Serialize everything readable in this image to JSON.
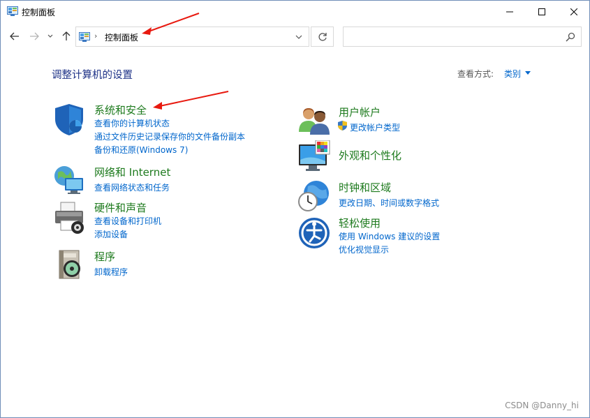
{
  "window": {
    "title": "控制面板"
  },
  "nav": {
    "back_icon": "arrow-left-icon",
    "forward_icon": "arrow-right-icon",
    "recent_icon": "chevron-down-icon",
    "up_icon": "arrow-up-icon"
  },
  "address": {
    "separator": "›",
    "path": "控制面板"
  },
  "search": {
    "placeholder": ""
  },
  "header": {
    "title": "调整计算机的设置",
    "viewby_label": "查看方式:",
    "viewby_value": "类别"
  },
  "categories": {
    "system": {
      "title": "系统和安全",
      "links": [
        "查看你的计算机状态",
        "通过文件历史记录保存你的文件备份副本",
        "备份和还原(Windows 7)"
      ]
    },
    "network": {
      "title": "网络和 Internet",
      "links": [
        "查看网络状态和任务"
      ]
    },
    "hardware": {
      "title": "硬件和声音",
      "links": [
        "查看设备和打印机",
        "添加设备"
      ]
    },
    "programs": {
      "title": "程序",
      "links": [
        "卸载程序"
      ]
    },
    "accounts": {
      "title": "用户帐户",
      "links": [
        "更改帐户类型"
      ]
    },
    "appearance": {
      "title": "外观和个性化",
      "links": []
    },
    "clock": {
      "title": "时钟和区域",
      "links": [
        "更改日期、时间或数字格式"
      ]
    },
    "ease": {
      "title": "轻松使用",
      "links": [
        "使用 Windows 建议的设置",
        "优化视觉显示"
      ]
    }
  },
  "watermark": "CSDN @Danny_hi",
  "colors": {
    "title_blue": "#1e3287",
    "category_green": "#1d7a1d",
    "link_blue": "#0066cc",
    "annotation_red": "#e8190f"
  }
}
